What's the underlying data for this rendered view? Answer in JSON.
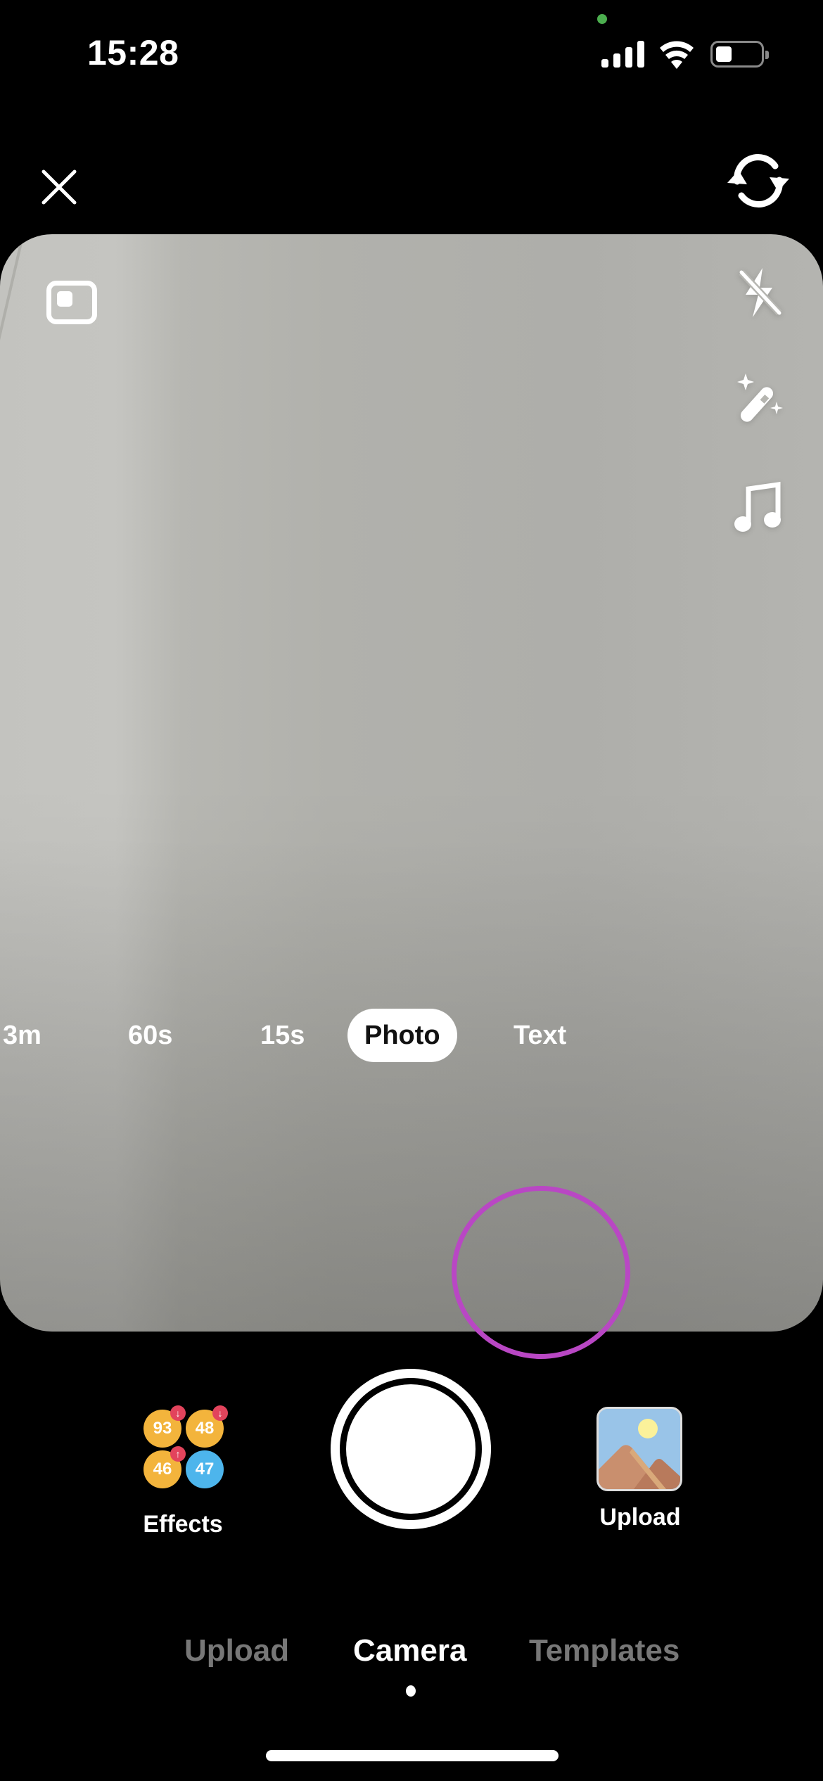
{
  "status_bar": {
    "time": "15:28",
    "signal_bars": 4,
    "wifi": "connected",
    "battery_percent": 30,
    "privacy_indicator_color": "#4cae4f"
  },
  "top_controls": {
    "close_icon": "close-icon",
    "flip_icon": "flip-camera-icon"
  },
  "side_tools": [
    {
      "name": "flash-off",
      "icon": "flash-off-icon"
    },
    {
      "name": "beautify",
      "icon": "magic-wand-icon"
    },
    {
      "name": "add-sound",
      "icon": "music-note-icon"
    }
  ],
  "aspect_ratio_icon": "aspect-ratio-icon",
  "modes": {
    "items": [
      {
        "label": "3m",
        "active": false
      },
      {
        "label": "60s",
        "active": false
      },
      {
        "label": "15s",
        "active": false
      },
      {
        "label": "Photo",
        "active": true
      },
      {
        "label": "Text",
        "active": false
      }
    ]
  },
  "effects": {
    "label": "Effects",
    "bubbles": [
      {
        "value": "93",
        "color": "#f3b43c",
        "badge": "down"
      },
      {
        "value": "48",
        "color": "#f3b43c",
        "badge": "down"
      },
      {
        "value": "46",
        "color": "#f3b43c",
        "badge": "up"
      },
      {
        "value": "47",
        "color": "#4db5ec",
        "badge": null
      }
    ],
    "badge_symbols": {
      "down": "↓",
      "up": "↑"
    }
  },
  "upload": {
    "label": "Upload"
  },
  "bottom_tabs": [
    {
      "label": "Upload",
      "active": false
    },
    {
      "label": "Camera",
      "active": true
    },
    {
      "label": "Templates",
      "active": false
    }
  ],
  "colors": {
    "annotation_circle": "#b947c4",
    "badge_red": "#e2445c",
    "inactive_tab": "#777777"
  }
}
